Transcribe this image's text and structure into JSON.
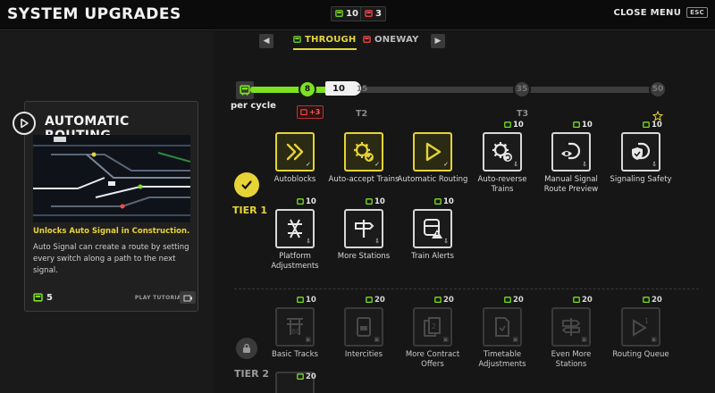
{
  "header": {
    "title": "SYSTEM UPGRADES",
    "close_label": "CLOSE MENU",
    "esc_label": "ESC"
  },
  "counters": {
    "green": "10",
    "red": "3"
  },
  "tabs": {
    "through": "THROUGH",
    "oneway": "ONEWAY"
  },
  "card": {
    "title": "AUTOMATIC ROUTING",
    "unlock_text": "Unlocks Auto Signal in Construction.",
    "description": "Auto Signal can create a route by setting every switch along a path to the next signal.",
    "cost": "5",
    "tutorial_label": "PLAY TUTORIAL"
  },
  "progress": {
    "per_cycle_label": "per cycle",
    "current_value": "10",
    "active_tick": "8",
    "ticks": [
      "8",
      "15",
      "35",
      "50"
    ],
    "tick_labels": [
      "T2",
      "T3"
    ],
    "bonus": "+3",
    "fill_fraction": 0.22
  },
  "tiers": {
    "tier1_label": "TIER 1",
    "tier2_label": "TIER 2",
    "tier1": [
      {
        "name": "Autoblocks",
        "price": "",
        "state": "active",
        "icon": "fast-forward-icon"
      },
      {
        "name": "Auto-accept Trains",
        "price": "",
        "state": "active",
        "icon": "gear-check-icon"
      },
      {
        "name": "Automatic Routing",
        "price": "",
        "state": "active",
        "icon": "play-icon"
      },
      {
        "name": "Auto-reverse Trains",
        "price": "10",
        "state": "available",
        "icon": "gear-reverse-icon"
      },
      {
        "name": "Manual Signal Route Preview",
        "price": "10",
        "state": "available",
        "icon": "signal-eye-icon"
      },
      {
        "name": "Signaling Safety",
        "price": "10",
        "state": "available",
        "icon": "signal-shield-icon"
      },
      {
        "name": "Platform Adjustments",
        "price": "10",
        "state": "available",
        "icon": "platform-icon"
      },
      {
        "name": "More Stations",
        "price": "10",
        "state": "available",
        "icon": "signpost-icon"
      },
      {
        "name": "Train Alerts",
        "price": "10",
        "state": "available",
        "icon": "train-alert-icon"
      }
    ],
    "tier2": [
      {
        "name": "Basic Tracks",
        "price": "10",
        "icon": "tracks-icon"
      },
      {
        "name": "Intercities",
        "price": "20",
        "icon": "intercity-icon"
      },
      {
        "name": "More Contract Offers",
        "price": "20",
        "icon": "contracts-icon"
      },
      {
        "name": "Timetable Adjustments",
        "price": "20",
        "icon": "timetable-icon"
      },
      {
        "name": "Even More Stations",
        "price": "20",
        "icon": "signpost-icon"
      },
      {
        "name": "Routing Queue",
        "price": "20",
        "icon": "routing-queue-icon"
      }
    ],
    "tier2_extra_price": "20"
  },
  "colors": {
    "accent_yellow": "#e6d335",
    "green": "#7ce21f",
    "red": "#ff4a4a"
  }
}
